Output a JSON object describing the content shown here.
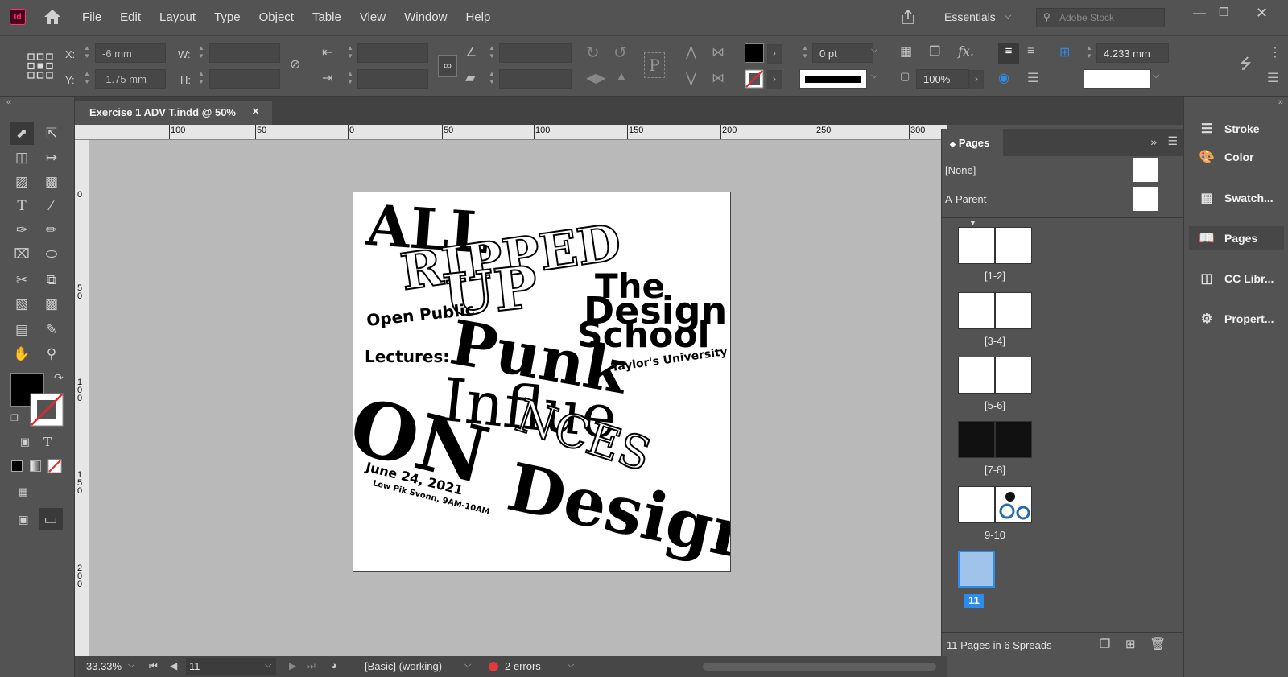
{
  "app": {
    "logo_text": "Id"
  },
  "menu": {
    "items": [
      "File",
      "Edit",
      "Layout",
      "Type",
      "Object",
      "Table",
      "View",
      "Window",
      "Help"
    ]
  },
  "workspace": {
    "label": "Essentials",
    "search_placeholder": "Adobe Stock"
  },
  "control": {
    "x_label": "X:",
    "x_value": "-6 mm",
    "y_label": "Y:",
    "y_value": "-1.75 mm",
    "w_label": "W:",
    "w_value": "",
    "h_label": "H:",
    "h_value": "",
    "stroke_weight": "0 pt",
    "scale_percent": "100%",
    "gap_value": "4.233 mm"
  },
  "document_tab": {
    "title": "Exercise 1 ADV T.indd @ 50%",
    "close": "×"
  },
  "ruler": {
    "h_ticks": [
      "100",
      "50",
      "0",
      "50",
      "100",
      "150",
      "200",
      "250",
      "300"
    ],
    "v_ticks": [
      "0",
      "5 0",
      "1 0 0",
      "1 5 0",
      "2 0 0"
    ]
  },
  "artwork": {
    "lines": [
      "ALL",
      "RIPPED",
      "UP",
      "The",
      "Design",
      "School",
      "Open Public",
      "Lectures:",
      "Punk",
      "Taylor's University",
      "Influe",
      "ON",
      "NCES",
      "Design",
      "June 24, 2021",
      "Lew Pik Svonn, 9AM-10AM"
    ]
  },
  "pages_panel": {
    "tab": "Pages",
    "parents": [
      {
        "label": "[None]"
      },
      {
        "label": "A-Parent"
      }
    ],
    "spreads": [
      {
        "label": "[1-2]"
      },
      {
        "label": "[3-4]"
      },
      {
        "label": "[5-6]"
      },
      {
        "label": "[7-8]"
      },
      {
        "label": "9-10"
      },
      {
        "label": "11"
      }
    ],
    "footer": "11 Pages in 6 Spreads"
  },
  "dock": {
    "items": [
      {
        "label": "Stroke",
        "icon": "stroke-icon"
      },
      {
        "label": "Color",
        "icon": "color-icon"
      },
      {
        "label": "Swatch...",
        "icon": "swatches-icon"
      },
      {
        "label": "Pages",
        "icon": "pages-icon"
      },
      {
        "label": "CC Libr...",
        "icon": "cc-libraries-icon"
      },
      {
        "label": "Propert...",
        "icon": "properties-icon"
      }
    ]
  },
  "status": {
    "zoom": "33.33%",
    "page": "11",
    "preflight_profile": "[Basic] (working)",
    "errors": "2 errors",
    "error_color": "#e03a3a"
  },
  "colors": {
    "ui_bg": "#535353",
    "pasteboard": "#b9b9b9",
    "accent": "#2d8ceb"
  }
}
